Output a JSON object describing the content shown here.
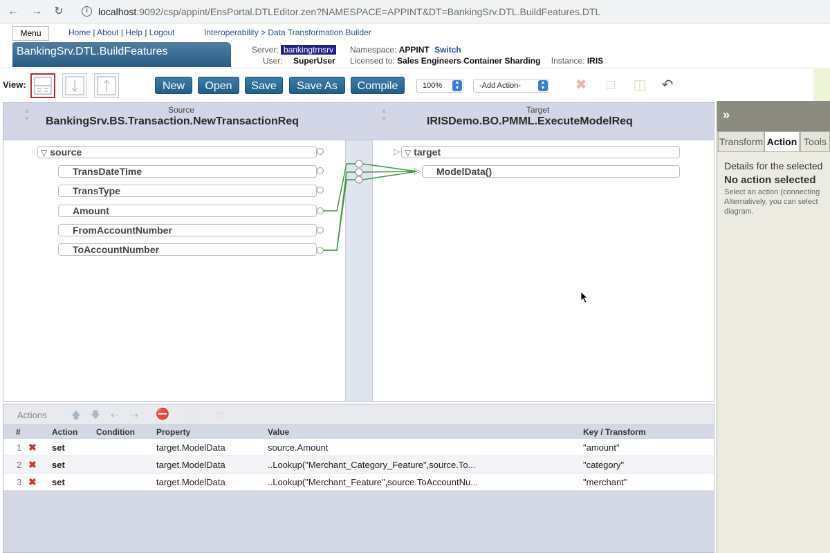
{
  "browser": {
    "url_host": "localhost",
    "url_rest": ":9092/csp/appint/EnsPortal.DTLEditor.zen?NAMESPACE=APPINT&DT=BankingSrv.DTL.BuildFeatures.DTL"
  },
  "portal": {
    "menu_label": "Menu",
    "links": [
      "Home",
      "About",
      "Help",
      "Logout"
    ],
    "breadcrumb": "Interoperability > Data Transformation Builder",
    "title": "BankingSrv.DTL.BuildFeatures",
    "server_label": "Server:",
    "server_value": "bankingtrnsrv",
    "user_label": "User:",
    "user_value": "SuperUser",
    "namespace_label": "Namespace:",
    "namespace_value": "APPINT",
    "switch_label": "Switch",
    "licensed_label": "Licensed to:",
    "licensed_value": "Sales Engineers Container Sharding",
    "instance_label": "Instance:",
    "instance_value": "IRIS"
  },
  "toolbar": {
    "view_label": "View:",
    "new_label": "New",
    "open_label": "Open",
    "save_label": "Save",
    "saveas_label": "Save As",
    "compile_label": "Compile",
    "zoom_value": "100%",
    "add_action_value": "-Add Action-"
  },
  "editor": {
    "source_caption": "Source",
    "source_class": "BankingSrv.BS.Transaction.NewTransactionReq",
    "target_caption": "Target",
    "target_class": "IRISDemo.BO.PMML.ExecuteModelReq",
    "source_root": "source",
    "source_fields": [
      "TransDateTime",
      "TransType",
      "Amount",
      "FromAccountNumber",
      "ToAccountNumber"
    ],
    "target_root": "target",
    "target_fields": [
      "ModelData()"
    ],
    "wire_color": "#3a9a3a"
  },
  "actions": {
    "title": "Actions",
    "columns": [
      "#",
      "Action",
      "Condition",
      "Property",
      "Value",
      "Key / Transform"
    ],
    "rows": [
      {
        "num": "1",
        "action": "set",
        "condition": "",
        "property": "target.ModelData",
        "value": "source.Amount",
        "key": "\"amount\""
      },
      {
        "num": "2",
        "action": "set",
        "condition": "",
        "property": "target.ModelData",
        "value": "..Lookup(\"Merchant_Category_Feature\",source.To...",
        "key": "\"category\""
      },
      {
        "num": "3",
        "action": "set",
        "condition": "",
        "property": "target.ModelData",
        "value": "..Lookup(\"Merchant_Feature\",source.ToAccountNu...",
        "key": "\"merchant\""
      }
    ]
  },
  "right_panel": {
    "tabs": [
      "Transform",
      "Action",
      "Tools"
    ],
    "selected_tab": "Action",
    "details_heading": "Details for the selected",
    "status": "No action selected",
    "help_line1": "Select an action (connecting",
    "help_line2": "Alternatively, you can select",
    "help_line3": "diagram."
  }
}
